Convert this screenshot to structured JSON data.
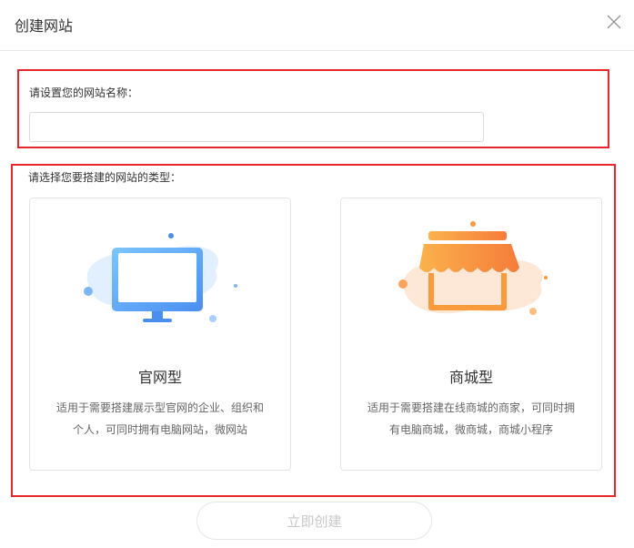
{
  "dialog": {
    "title": "创建网站",
    "close_icon": "close-icon"
  },
  "name_section": {
    "label": "请设置您的网站名称：",
    "input_value": "",
    "input_placeholder": ""
  },
  "type_section": {
    "label": "请选择您要搭建的网站的类型：",
    "cards": [
      {
        "title": "官网型",
        "desc_line1": "适用于需要搭建展示型官网的企业、组织和",
        "desc_line2": "个人，可同时拥有电脑网站，微网站",
        "icon": "monitor-icon"
      },
      {
        "title": "商城型",
        "desc_line1": "适用于需要搭建在线商城的商家，可同时拥",
        "desc_line2": "有电脑商城，微商城，商城小程序",
        "icon": "storefront-icon"
      }
    ]
  },
  "footer": {
    "create_label": "立即创建"
  },
  "colors": {
    "highlight_border": "#e8262b",
    "monitor_blue": "#5aa8f5",
    "store_orange": "#f99a3c",
    "disabled_text": "#c8c8c8"
  }
}
